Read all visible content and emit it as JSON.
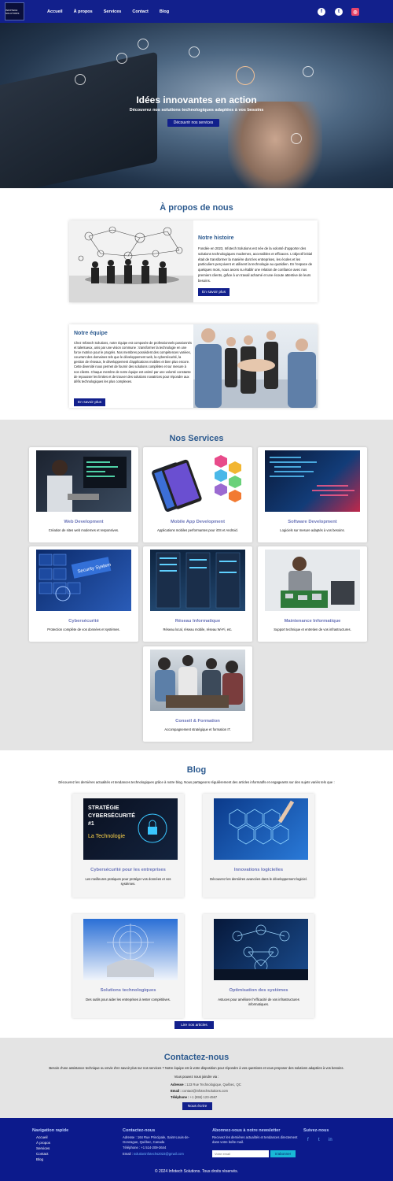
{
  "nav": {
    "logo_text": "INFOTECH SOLUTIONS",
    "links": [
      "Accueil",
      "À propos",
      "Services",
      "Contact",
      "Blog"
    ]
  },
  "hero": {
    "title": "Idées innovantes en action",
    "subtitle": "Découvrez nos solutions technologiques adaptées à vos besoins",
    "button": "Découvrir nos services"
  },
  "about": {
    "title": "À propos de nous",
    "history": {
      "heading": "Notre histoire",
      "text": "Fondée en 2023, Infotech Solutions est née de la volonté d'apporter des solutions technologiques modernes, accessibles et efficaces. L'objectif initial était de transformer la manière dont les entreprises, les écoles et les particuliers perçoivent et utilisent la technologie au quotidien. En l'espace de quelques mois, nous avons su établir une relation de confiance avec nos premiers clients, grâce à un travail acharné et une écoute attentive de leurs besoins.",
      "button": "En savoir plus"
    },
    "team": {
      "heading": "Notre équipe",
      "text": "Chez Infotech Solutions, notre équipe est composée de professionnels passionnés et talentueux, unis par une vision commune : transformer la technologie en une force motrice pour le progrès. Nos membres possèdent des compétences variées, couvrant des domaines tels que le développement web, la cybersécurité, la gestion de réseaux, le développement d'applications mobiles et bien plus encore. Cette diversité nous permet de fournir des solutions complètes et sur mesure à nos clients. Chaque membre de notre équipe est animé par une volonté constante de repousser les limites et de trouver des solutions novatrices pour répondre aux défis technologiques les plus complexes.",
      "button": "En savoir plus"
    }
  },
  "services": {
    "title": "Nos Services",
    "items": [
      {
        "title": "Web Development",
        "desc": "Création de sites web modernes et responsives."
      },
      {
        "title": "Mobile App Development",
        "desc": "Applications mobiles performantes pour iOS et Android."
      },
      {
        "title": "Software Development",
        "desc": "Logiciels sur mesure adaptés à vos besoins."
      },
      {
        "title": "Cybersécurité",
        "desc": "Protection complète de vos données et systèmes."
      },
      {
        "title": "Réseau Informatique",
        "desc": "Réseau local, réseau mobile, réseau Wi-Fi, etc."
      },
      {
        "title": "Maintenance Informatique",
        "desc": "Support technique et entretien de vos infrastructures."
      },
      {
        "title": "Conseil & Formation",
        "desc": "Accompagnement stratégique et formation IT."
      }
    ],
    "security_badge": "Security System"
  },
  "blog": {
    "title": "Blog",
    "intro": "Découvrez les dernières actualités et tendances technologiques grâce à notre blog. Nous partageons régulièrement des articles informatifs et engageants sur des sujets variés tels que :",
    "cover": {
      "line1": "STRATÉGIE",
      "line2": "CYBERSÉCURITÉ",
      "line3": "#1",
      "line4": "La Technologie"
    },
    "items": [
      {
        "title": "Cybersécurité pour les entreprises",
        "desc": "Les meilleures pratiques pour protéger vos données et vos systèmes."
      },
      {
        "title": "Innovations logicielles",
        "desc": "Découvrez les dernières avancées dans le développement logiciel."
      },
      {
        "title": "Solutions technologiques",
        "desc": "Des outils pour aider les entreprises à rester compétitives."
      },
      {
        "title": "Optimisation des systèmes",
        "desc": "Astuces pour améliorer l'efficacité de vos infrastructures informatiques."
      }
    ],
    "button": "Lire nos articles"
  },
  "contact": {
    "title": "Contactez-nous",
    "intro": "Besoin d'une assistance technique ou envie d'en savoir plus sur nos services ? Notre équipe est à votre disposition pour répondre à vos questions et vous proposer des solutions adaptées à vos besoins.",
    "reach": "Vous pouvez nous joindre via :",
    "address_label": "Adresse :",
    "address": "123 Rue Technologique, Québec, QC",
    "email_label": "Email :",
    "email": "contact@infotechsolutions.com",
    "phone_label": "Téléphone :",
    "phone": "+1 (555) 123-4567",
    "button": "Nous écrire"
  },
  "footer": {
    "nav_title": "Navigation rapide",
    "nav_links": [
      "Accueil",
      "À propos",
      "Services",
      "Contact",
      "Blog"
    ],
    "contact_title": "Contactez-nous",
    "address_label": "Adresse :",
    "address": "164 Rue Principale, Saint-Louis-de-Gonzague, Québec, Canada",
    "phone_label": "Téléphone :",
    "phone": "+1 514-209-3644",
    "email_label": "Email :",
    "email": "solutioninfotechs2023@gmail.com",
    "newsletter_title": "Abonnez-vous à notre newsletter",
    "newsletter_text": "Recevez les dernières actualités et tendances directement dans votre boîte mail.",
    "newsletter_placeholder": "Votre email",
    "newsletter_button": "S'abonner",
    "follow_title": "Suivez-nous",
    "copyright": "© 2024 Infotech Solutions. Tous droits réservés."
  },
  "colors": {
    "nav_bg": "#12208c",
    "heading_blue": "#2c5a8f",
    "service_title": "#6a74b8",
    "footer_bg": "#0c1a8c",
    "newsletter_button": "#19b8d6"
  }
}
